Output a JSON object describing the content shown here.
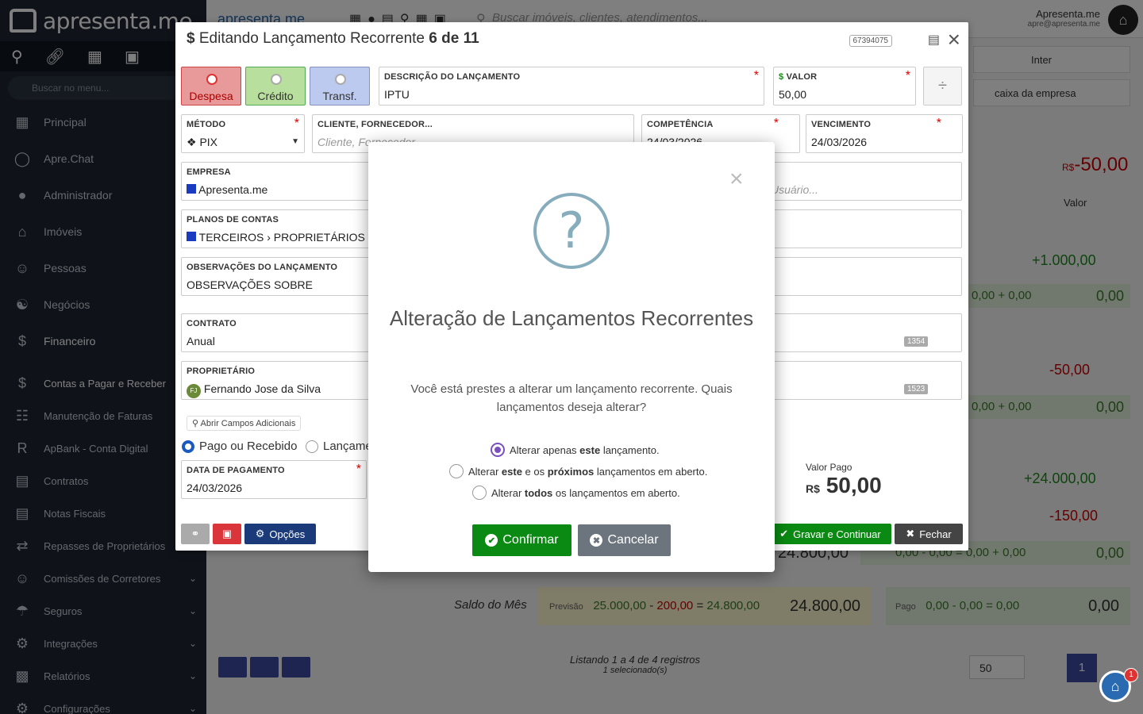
{
  "app": {
    "logo_text": "apresenta.me"
  },
  "sidebar": {
    "search_placeholder": "Buscar no menu...",
    "items": [
      {
        "label": "Principal"
      },
      {
        "label": "Apre.Chat"
      },
      {
        "label": "Administrador"
      },
      {
        "label": "Imóveis"
      },
      {
        "label": "Pessoas"
      },
      {
        "label": "Negócios"
      },
      {
        "label": "Financeiro"
      }
    ],
    "subitems": [
      {
        "label": "Contas a Pagar e Receber"
      },
      {
        "label": "Manutenção de Faturas"
      },
      {
        "label": "ApBank - Conta Digital"
      },
      {
        "label": "Contratos"
      },
      {
        "label": "Notas Fiscais"
      },
      {
        "label": "Repasses de Proprietários"
      },
      {
        "label": "Comissões de Corretores"
      },
      {
        "label": "Seguros"
      },
      {
        "label": "Integrações"
      },
      {
        "label": "Relatórios"
      },
      {
        "label": "Configurações"
      }
    ]
  },
  "topbar": {
    "search_placeholder": "Buscar imóveis, clientes, atendimentos...",
    "user_name": "Apresenta.me",
    "user_email": "apre@apresenta.me",
    "notif_count": "1"
  },
  "background": {
    "bank1": "Inter",
    "bank2": "caixa da empresa",
    "total_neg": "-50,00",
    "total_prefix": "R$",
    "col_valor": "Valor",
    "row1_val": "+1.000,00",
    "row1_sub": "0,00 + 0,00",
    "row1_sub2": "0,00",
    "row2_val": "-50,00",
    "row2_sub": "0,00 + 0,00",
    "row2_sub2": "0,00",
    "row3_val": "+24.000,00",
    "row4_val": "-150,00",
    "row4_sub": "0,00 - 0,00 = 0,00 + 0,00",
    "row4_sub2": "0,00",
    "big_val": "24.800,00",
    "saldo_label": "Saldo do Mês",
    "previsao_label": "Previsão",
    "previsao_a": "25.000,00",
    "previsao_b": "200,00",
    "previsao_c": "24.800,00",
    "saldo_val": "24.800,00",
    "pago_label": "Pago",
    "pago_expr": "0,00 - 0,00 = 0,00",
    "pago_val": "0,00",
    "listing": "Listando 1 a 4 de 4 registros",
    "selected": "1 selecionado(s)",
    "page_size": "50",
    "page": "1"
  },
  "editor": {
    "title_prefix": "Editando Lançamento Recorrente",
    "title_counter": "6 de 11",
    "record_id": "67394075",
    "types": [
      {
        "label": "Despesa",
        "color": "#e8a0a0",
        "border": "#c44"
      },
      {
        "label": "Crédito",
        "color": "#b8e0a8",
        "border": "#5a5"
      },
      {
        "label": "Transf.",
        "color": "#b8c8f0",
        "border": "#668"
      }
    ],
    "descricao_label": "DESCRIÇÃO DO LANÇAMENTO",
    "descricao_value": "IPTU",
    "valor_label": "VALOR",
    "valor_value": "50,00",
    "metodo_label": "MÉTODO",
    "metodo_value": "PIX",
    "cliente_label": "CLIENTE, FORNECEDOR...",
    "cliente_placeholder": "Cliente, Fornecedor...",
    "competencia_label": "COMPETÊNCIA",
    "competencia_value": "24/03/2026",
    "vencimento_label": "VENCIMENTO",
    "vencimento_value": "24/03/2026",
    "empresa_label": "EMPRESA",
    "empresa_value": "Apresenta.me",
    "usuario_placeholder": "Usuário...",
    "planos_label": "PLANOS DE CONTAS",
    "planos_value": "TERCEIROS › PROPRIETÁRIOS › IP",
    "obs_label": "OBSERVAÇÕES DO LANÇAMENTO",
    "obs_value": "OBSERVAÇÕES SOBRE",
    "contrato_label": "CONTRATO",
    "contrato_value": "Anual",
    "contrato_id": "1354",
    "proprietario_label": "PROPRIETÁRIO",
    "proprietario_value": "Fernando Jose da Silva",
    "proprietario_initials": "FJ",
    "proprietario_id": "1523",
    "campos_label": "Abrir Campos Adicionais",
    "pago_radio": "Pago ou Recebido",
    "lanc_radio": "Lançame",
    "data_pag_label": "DATA DE PAGAMENTO",
    "data_pag_value": "24/03/2026",
    "valor_pago_label": "Valor Pago",
    "valor_pago_prefix": "R$",
    "valor_pago_value": "50,00",
    "opcoes_label": "Opções",
    "gravar_label": "Gravar e Continuar",
    "fechar_label": "Fechar"
  },
  "dialog": {
    "title": "Alteração de Lançamentos Recorrentes",
    "text": "Você está prestes a alterar um lançamento recorrente. Quais lançamentos deseja alterar?",
    "options": [
      {
        "pre": "Alterar apenas ",
        "bold": "este",
        "post": " lançamento.",
        "checked": true
      },
      {
        "pre": "Alterar ",
        "bold": "este",
        "mid": " e os ",
        "bold2": "próximos",
        "post": " lançamentos em aberto.",
        "checked": false
      },
      {
        "pre": "Alterar ",
        "bold": "todos",
        "post": " os lançamentos em aberto.",
        "checked": false
      }
    ],
    "confirm_label": "Confirmar",
    "cancel_label": "Cancelar"
  }
}
